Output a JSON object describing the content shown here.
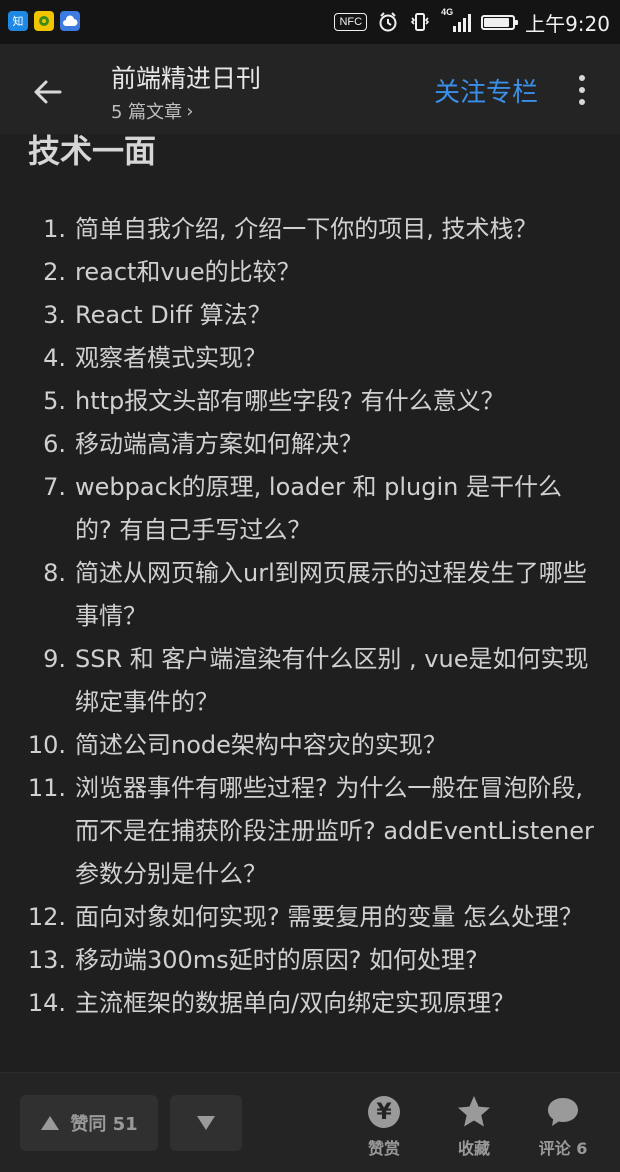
{
  "status_bar": {
    "nfc_label": "NFC",
    "network_type": "4G",
    "time": "上午9:20",
    "battery_level": 0.9,
    "left_icons": [
      "zhihu-app-icon",
      "game-app-icon",
      "cloud-app-icon"
    ]
  },
  "header": {
    "title": "前端精进日刊",
    "subtitle": "5 篇文章",
    "subtitle_chevron": "›",
    "follow_label": "关注专栏",
    "follow_color": "#3a8fe8"
  },
  "article": {
    "section_heading": "技术一面",
    "questions": [
      {
        "num": "1.",
        "text": "简单自我介绍, 介绍一下你的项目, 技术栈？"
      },
      {
        "num": "2.",
        "text": "react和vue的比较？"
      },
      {
        "num": "3.",
        "text": "React Diff 算法？"
      },
      {
        "num": "4.",
        "text": "观察者模式实现？"
      },
      {
        "num": "5.",
        "text": "http报文头部有哪些字段? 有什么意义？"
      },
      {
        "num": "6.",
        "text": "移动端高清方案如何解决？"
      },
      {
        "num": "7.",
        "text": "webpack的原理, loader 和 plugin 是干什么的? 有自己手写过么？"
      },
      {
        "num": "8.",
        "text": "简述从网页输入url到网页展示的过程发生了哪些事情？"
      },
      {
        "num": "9.",
        "text": "SSR 和 客户端渲染有什么区别 , vue是如何实现绑定事件的？"
      },
      {
        "num": "10.",
        "text": "简述公司node架构中容灾的实现？"
      },
      {
        "num": "11.",
        "text": "浏览器事件有哪些过程? 为什么一般在冒泡阶段, 而不是在捕获阶段注册监听? addEventListener 参数分别是什么？"
      },
      {
        "num": "12.",
        "text": "面向对象如何实现? 需要复用的变量 怎么处理？"
      },
      {
        "num": "13.",
        "text": "移动端300ms延时的原因? 如何处理?"
      },
      {
        "num": "14.",
        "text": "主流框架的数据单向/双向绑定实现原理？"
      }
    ]
  },
  "bottom_bar": {
    "vote_up_label": "赞同 51",
    "reward_label": "赞赏",
    "reward_symbol": "¥",
    "favorite_label": "收藏",
    "comment_label": "评论 6"
  }
}
